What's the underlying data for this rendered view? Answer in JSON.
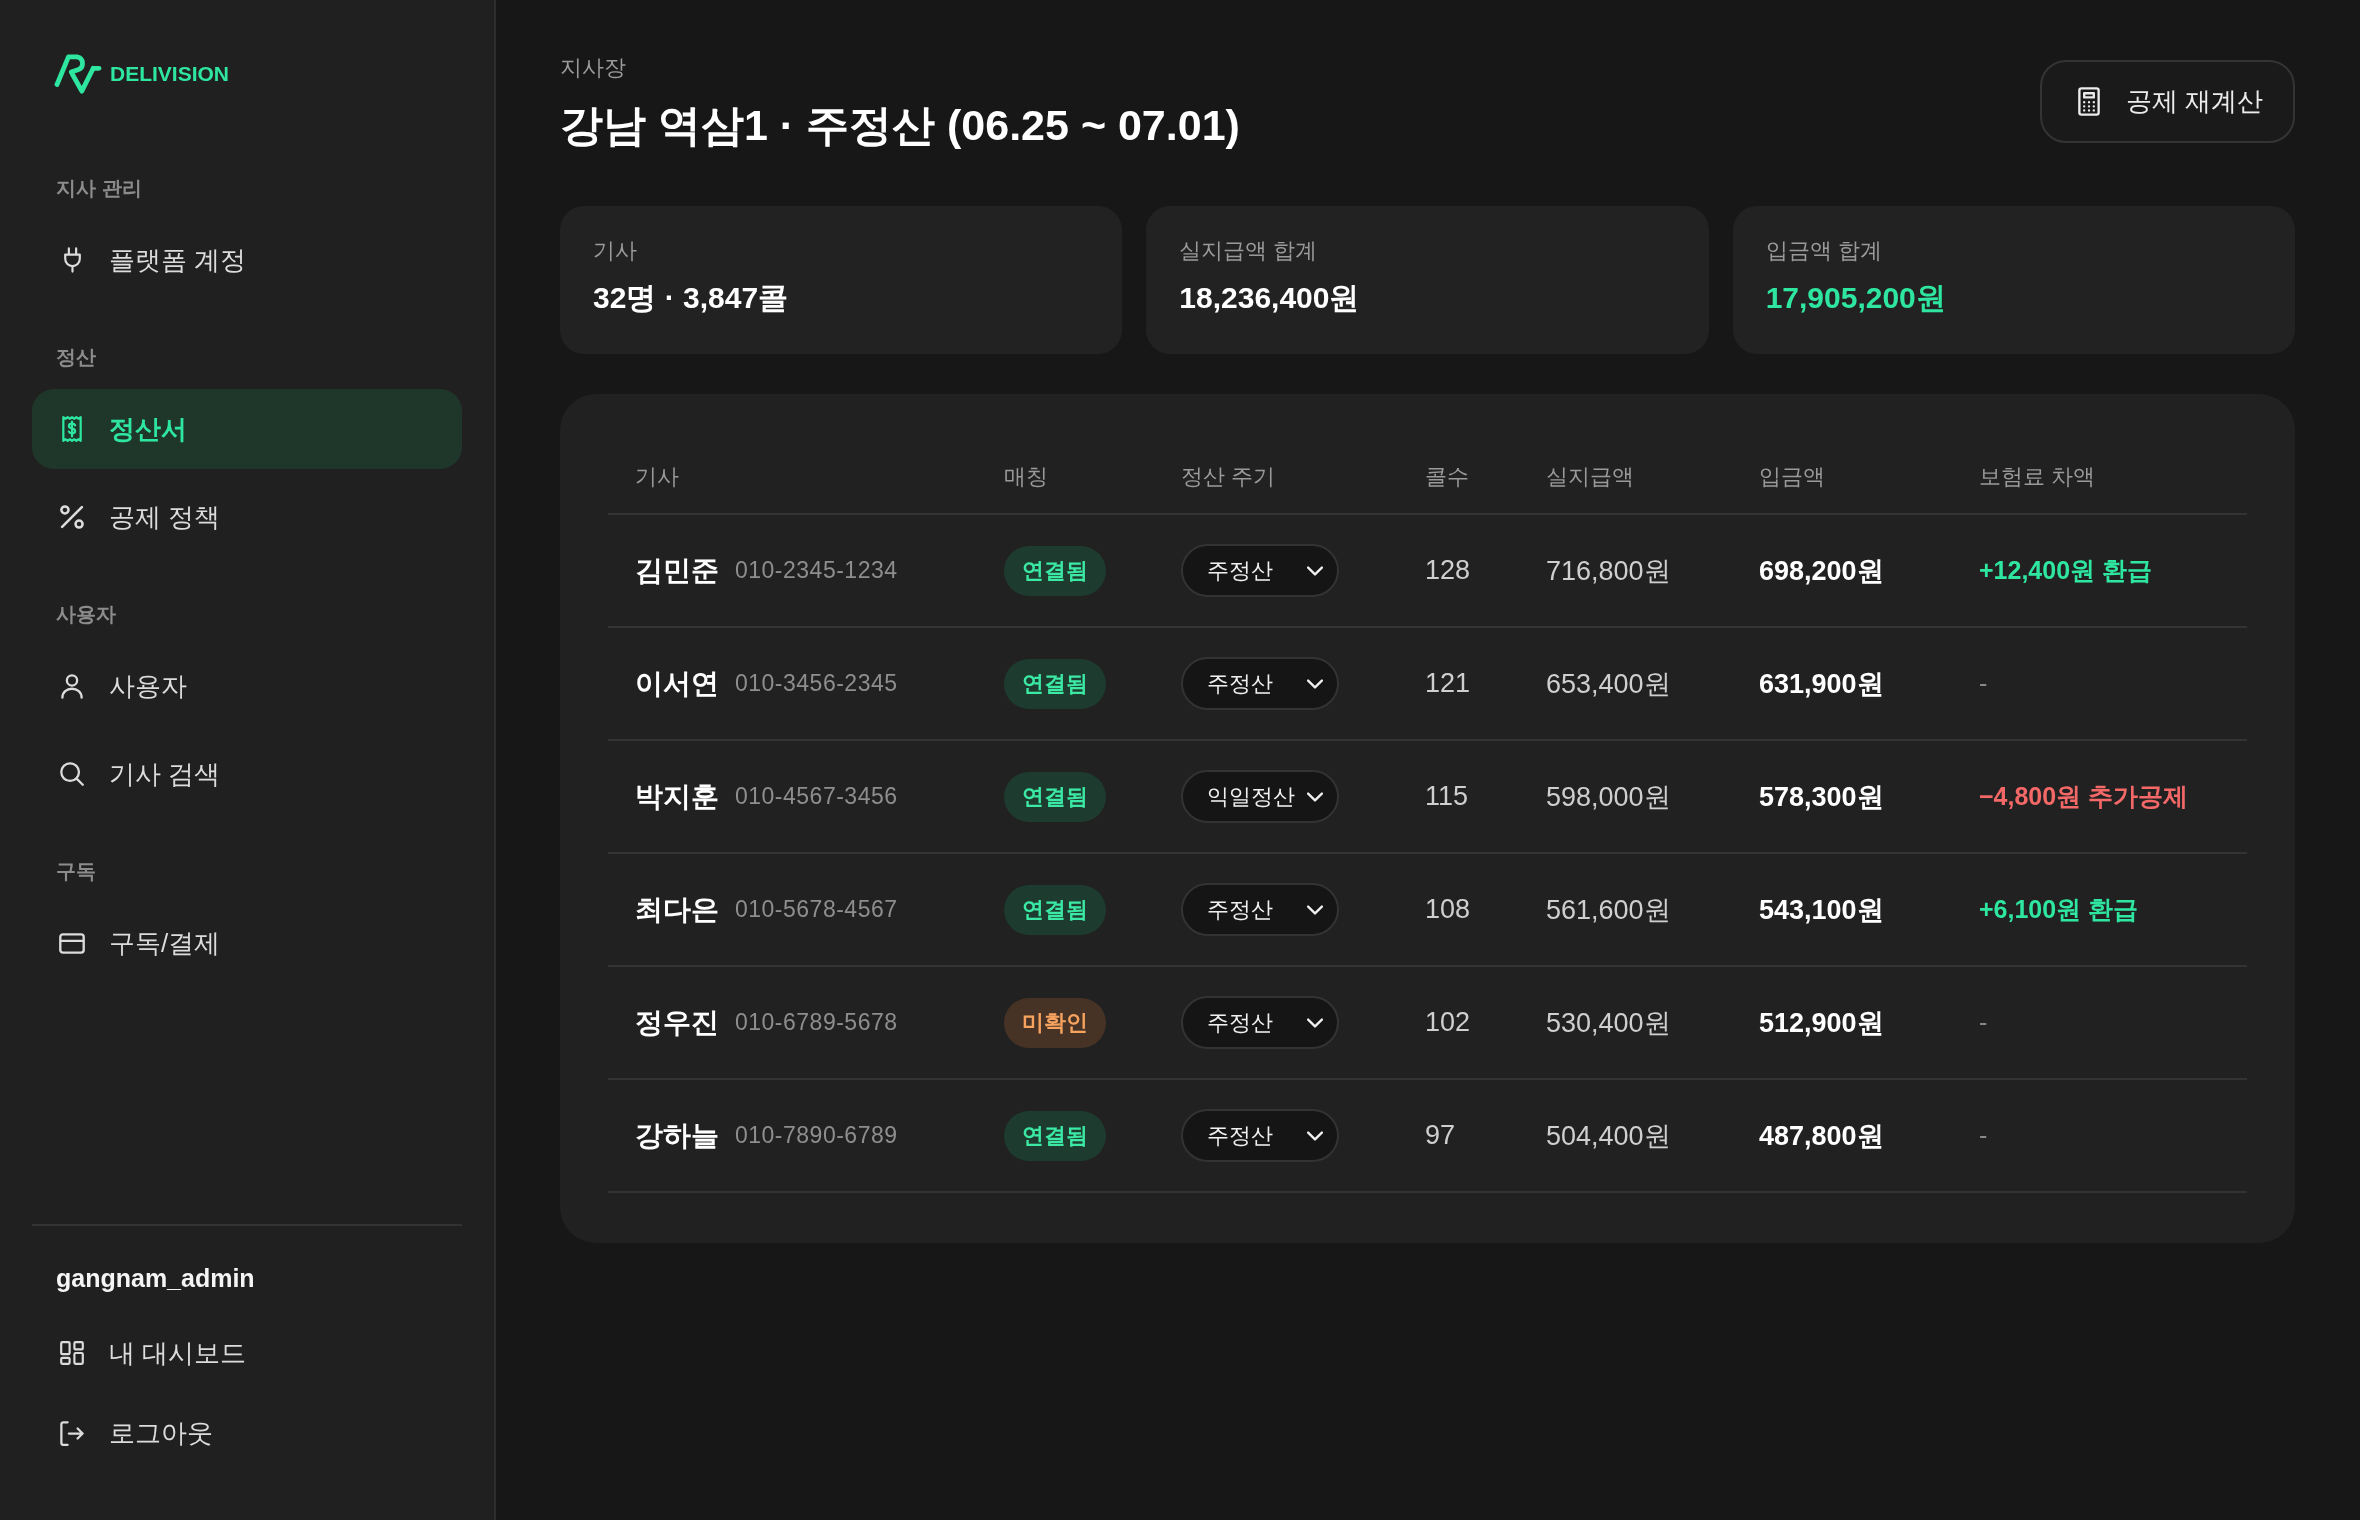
{
  "sidebar": {
    "logo": {
      "text": "DELIVISION"
    },
    "sections": [
      {
        "label": "지사 관리",
        "items": [
          {
            "label": "플랫폼 계정",
            "selected": false
          }
        ]
      },
      {
        "label": "정산",
        "items": [
          {
            "label": "정산서",
            "selected": true
          },
          {
            "label": "공제 정책",
            "selected": false
          }
        ]
      },
      {
        "label": "사용자",
        "items": [
          {
            "label": "사용자",
            "selected": false
          },
          {
            "label": "기사 검색",
            "selected": false
          }
        ]
      },
      {
        "label": "구독",
        "items": [
          {
            "label": "구독/결제",
            "selected": false
          }
        ]
      }
    ],
    "account": {
      "username": "gangnam_admin",
      "links": [
        {
          "label": "내 대시보드"
        },
        {
          "label": "로그아웃"
        }
      ]
    }
  },
  "header": {
    "eyebrow": "지사장",
    "title": "강남 역삼1 · 주정산 (06.25 ~ 07.01)",
    "action": {
      "label": "공제 재계산"
    }
  },
  "stats": [
    {
      "label": "기사",
      "value": "32명 · 3,847콜",
      "highlighted": false
    },
    {
      "label": "실지급액 합계",
      "value": "18,236,400원",
      "highlighted": false
    },
    {
      "label": "입금액 합계",
      "value": "17,905,200원",
      "highlighted": true
    }
  ],
  "table": {
    "columns": [
      "기사",
      "매칭",
      "정산 주기",
      "콜수",
      "실지급액",
      "입금액",
      "보험료 차액"
    ],
    "rows": [
      {
        "name": "김민준",
        "phone": "010-2345-1234",
        "match": {
          "label": "연결됨",
          "kind": "linked"
        },
        "cycle": "주정산",
        "calls": "128",
        "paid": "716,800원",
        "deposit": "698,200원",
        "difference": {
          "text": "+12,400원 환급",
          "kind": "refund"
        }
      },
      {
        "name": "이서연",
        "phone": "010-3456-2345",
        "match": {
          "label": "연결됨",
          "kind": "linked"
        },
        "cycle": "주정산",
        "calls": "121",
        "paid": "653,400원",
        "deposit": "631,900원",
        "difference": {
          "text": "-",
          "kind": "none"
        }
      },
      {
        "name": "박지훈",
        "phone": "010-4567-3456",
        "match": {
          "label": "연결됨",
          "kind": "linked"
        },
        "cycle": "익일정산",
        "calls": "115",
        "paid": "598,000원",
        "deposit": "578,300원",
        "difference": {
          "text": "−4,800원 추가공제",
          "kind": "deduction"
        }
      },
      {
        "name": "최다은",
        "phone": "010-5678-4567",
        "match": {
          "label": "연결됨",
          "kind": "linked"
        },
        "cycle": "주정산",
        "calls": "108",
        "paid": "561,600원",
        "deposit": "543,100원",
        "difference": {
          "text": "+6,100원 환급",
          "kind": "refund"
        }
      },
      {
        "name": "정우진",
        "phone": "010-6789-5678",
        "match": {
          "label": "미확인",
          "kind": "unconfirmed"
        },
        "cycle": "주정산",
        "calls": "102",
        "paid": "530,400원",
        "deposit": "512,900원",
        "difference": {
          "text": "-",
          "kind": "none"
        }
      },
      {
        "name": "강하늘",
        "phone": "010-7890-6789",
        "match": {
          "label": "연결됨",
          "kind": "linked"
        },
        "cycle": "주정산",
        "calls": "97",
        "paid": "504,400원",
        "deposit": "487,800원",
        "difference": {
          "text": "-",
          "kind": "none"
        }
      }
    ]
  }
}
